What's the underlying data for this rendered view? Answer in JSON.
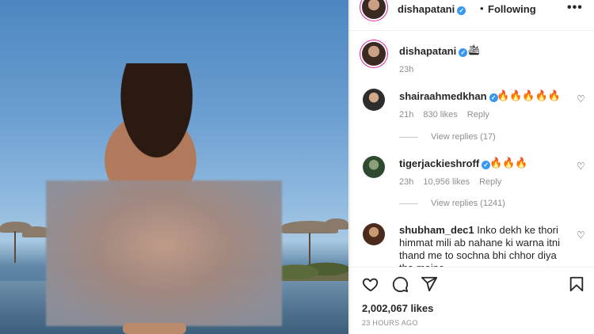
{
  "post": {
    "username": "dishapatani",
    "follow_status": "Following",
    "caption_emoji": "🛳",
    "caption_time": "23h",
    "likes": "2,002,067 likes",
    "posted_ago": "23 HOURS AGO"
  },
  "comments": [
    {
      "username": "shairaahmedkhan",
      "verified": true,
      "text": "🔥🔥🔥🔥🔥",
      "time": "21h",
      "likes": "830 likes",
      "reply_label": "Reply",
      "view_replies": "View replies (17)"
    },
    {
      "username": "tigerjackieshroff",
      "verified": true,
      "text": "🔥🔥🔥",
      "time": "23h",
      "likes": "10,956 likes",
      "reply_label": "Reply",
      "view_replies": "View replies (1241)"
    },
    {
      "username": "shubham_dec1",
      "verified": false,
      "text": "Inko dekh ke thori himmat mili ab nahane ki warna itni thand me to sochna bhi chhor diya tha maine"
    }
  ],
  "icons": {
    "more": "more-options-icon",
    "like": "heart-icon",
    "comment": "comment-icon",
    "share": "paper-plane-icon",
    "save": "bookmark-icon",
    "verified": "verified-badge-icon"
  },
  "colors": {
    "verified": "#3897f0",
    "secondary_text": "#8e8e8e",
    "primary_text": "#262626"
  }
}
